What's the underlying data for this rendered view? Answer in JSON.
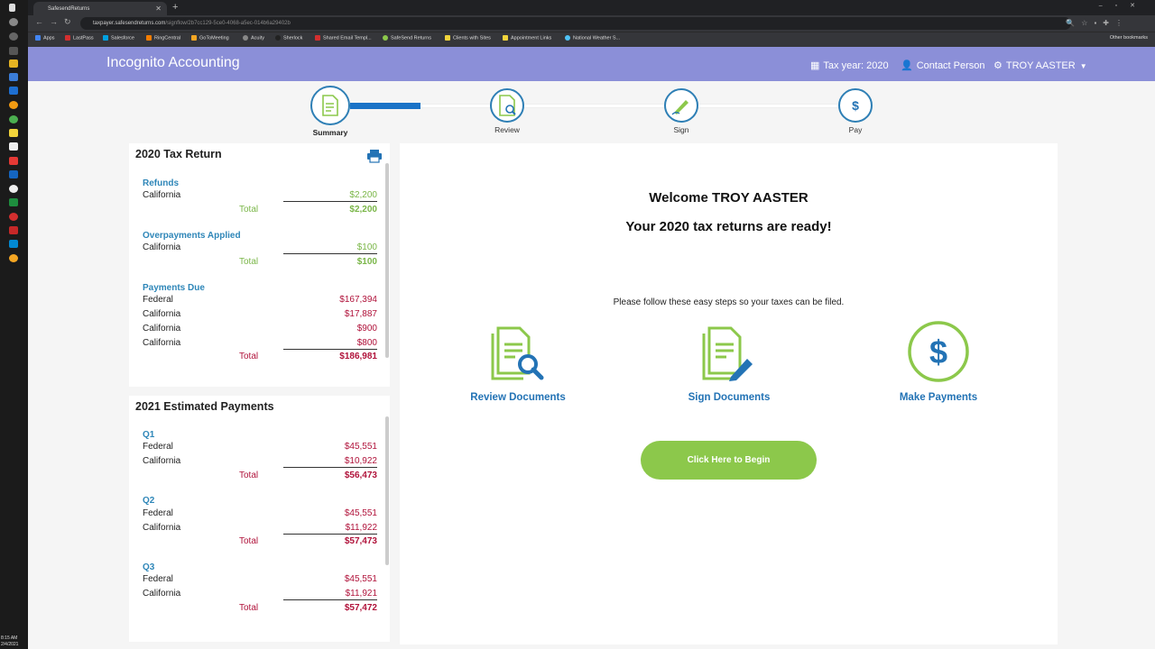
{
  "taskbar": {
    "time": "8:15 AM",
    "date": "2/4/2021"
  },
  "browser": {
    "tab_title": "SafesendReturns",
    "url_host": "taxpayer.safesendreturns.com",
    "url_path": "/signflow/2b7cc129-5ce0-4068-a5ec-014b6a29402b",
    "bookmarks": [
      "Apps",
      "LastPass",
      "Salesforce",
      "RingCentral",
      "GoToMeeting",
      "Acuity",
      "Sherlock",
      "Shared Email Templ...",
      "SafeSend Returns",
      "Clients with Sites",
      "Appointment Links",
      "National Weather S..."
    ],
    "other_bookmarks": "Other bookmarks"
  },
  "header": {
    "title": "Incognito Accounting",
    "tax_year": "Tax year: 2020",
    "contact": "Contact Person",
    "user": "TROY AASTER"
  },
  "steps": [
    {
      "label": "Summary",
      "active": true
    },
    {
      "label": "Review",
      "active": false
    },
    {
      "label": "Sign",
      "active": false
    },
    {
      "label": "Pay",
      "active": false
    }
  ],
  "tax_return": {
    "title": "2020 Tax Return",
    "refunds": {
      "title": "Refunds",
      "rows": [
        {
          "label": "California",
          "amount": "$2,200"
        }
      ],
      "total_label": "Total",
      "total": "$2,200"
    },
    "overpayments": {
      "title": "Overpayments Applied",
      "rows": [
        {
          "label": "California",
          "amount": "$100"
        }
      ],
      "total_label": "Total",
      "total": "$100"
    },
    "payments_due": {
      "title": "Payments Due",
      "rows": [
        {
          "label": "Federal",
          "amount": "$167,394"
        },
        {
          "label": "California",
          "amount": "$17,887"
        },
        {
          "label": "California",
          "amount": "$900"
        },
        {
          "label": "California",
          "amount": "$800"
        }
      ],
      "total_label": "Total",
      "total": "$186,981"
    }
  },
  "estimated": {
    "title": "2021 Estimated Payments",
    "quarters": [
      {
        "title": "Q1",
        "rows": [
          {
            "label": "Federal",
            "amount": "$45,551"
          },
          {
            "label": "California",
            "amount": "$10,922"
          }
        ],
        "total_label": "Total",
        "total": "$56,473"
      },
      {
        "title": "Q2",
        "rows": [
          {
            "label": "Federal",
            "amount": "$45,551"
          },
          {
            "label": "California",
            "amount": "$11,922"
          }
        ],
        "total_label": "Total",
        "total": "$57,473"
      },
      {
        "title": "Q3",
        "rows": [
          {
            "label": "Federal",
            "amount": "$45,551"
          },
          {
            "label": "California",
            "amount": "$11,921"
          }
        ],
        "total_label": "Total",
        "total": "$57,472"
      }
    ]
  },
  "main": {
    "welcome": "Welcome TROY AASTER",
    "ready": "Your 2020 tax returns are ready!",
    "instructions": "Please follow these easy steps so your taxes can be filed.",
    "actions": [
      {
        "label": "Review Documents",
        "icon": "review-documents-icon"
      },
      {
        "label": "Sign Documents",
        "icon": "sign-documents-icon"
      },
      {
        "label": "Make Payments",
        "icon": "dollar-icon"
      }
    ],
    "begin_button": "Click Here to Begin"
  },
  "colors": {
    "header": "#8b8fd8",
    "accent_blue": "#2373b5",
    "green": "#8cc84b",
    "red": "#b0123a"
  }
}
